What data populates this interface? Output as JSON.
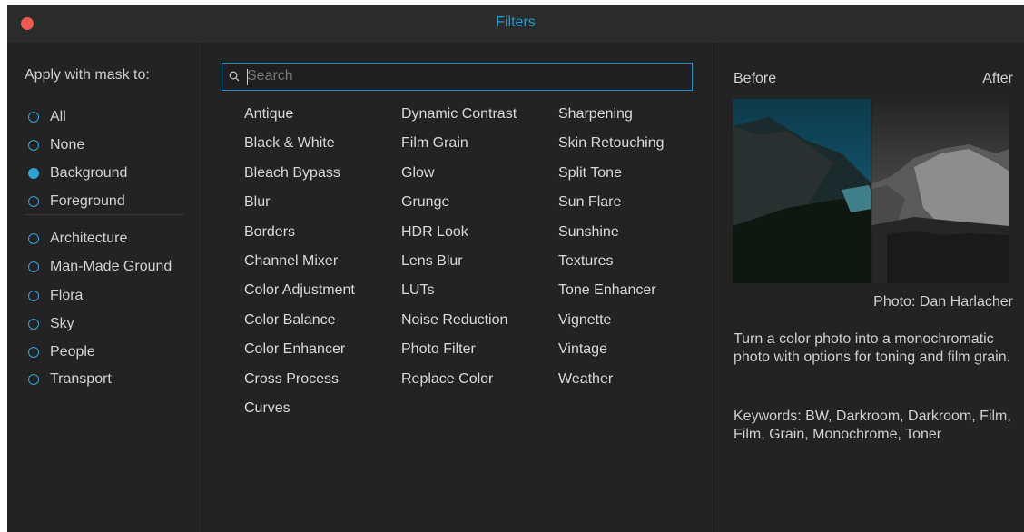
{
  "window": {
    "title": "Filters"
  },
  "mask": {
    "heading": "Apply with mask to:",
    "options": [
      "All",
      "None",
      "Background",
      "Foreground"
    ],
    "categories": [
      "Architecture",
      "Man-Made Ground",
      "Flora",
      "Sky",
      "People",
      "Transport"
    ],
    "selected": "Background"
  },
  "search": {
    "placeholder": "Search",
    "value": ""
  },
  "filters": {
    "col1": [
      "Antique",
      "Black & White",
      "Bleach Bypass",
      "Blur",
      "Borders",
      "Channel Mixer",
      "Color Adjustment",
      "Color Balance",
      "Color Enhancer",
      "Cross Process",
      "Curves"
    ],
    "col2": [
      "Dynamic Contrast",
      "Film Grain",
      "Glow",
      "Grunge",
      "HDR Look",
      "Lens Blur",
      "LUTs",
      "Noise Reduction",
      "Photo Filter",
      "Replace Color"
    ],
    "col3": [
      "Sharpening",
      "Skin Retouching",
      "Split Tone",
      "Sun Flare",
      "Sunshine",
      "Textures",
      "Tone Enhancer",
      "Vignette",
      "Vintage",
      "Weather"
    ]
  },
  "preview": {
    "before_label": "Before",
    "after_label": "After",
    "credit": "Photo: Dan Harlacher",
    "description": "Turn a color photo into a monochromatic photo with options for toning and film grain.",
    "keywords": "Keywords: BW, Darkroom, Darkroom, Film, Film, Grain, Monochrome, Toner"
  },
  "colors": {
    "accent": "#1f9bd1",
    "close": "#ee5a4f",
    "background": "#232323"
  }
}
